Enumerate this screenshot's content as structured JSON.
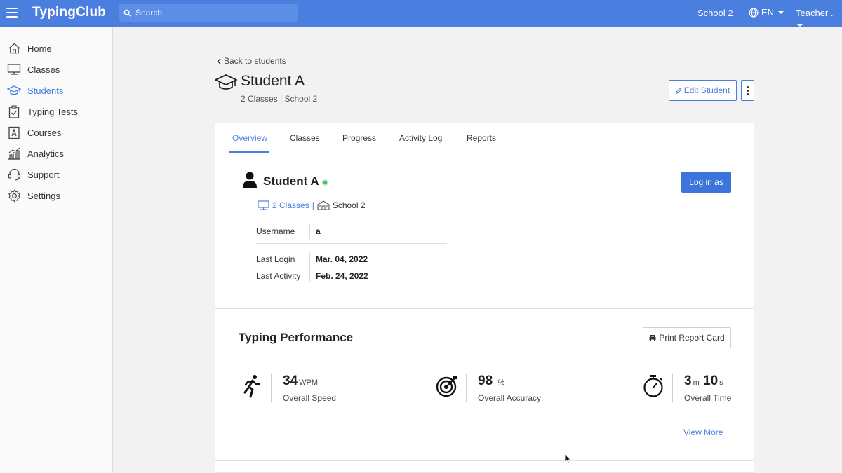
{
  "topbar": {
    "logo": "TypingClub",
    "search_placeholder": "Search",
    "school": "School 2",
    "language": "EN",
    "user": "Teacher ."
  },
  "sidebar": {
    "items": [
      {
        "label": "Home",
        "icon": "home-icon"
      },
      {
        "label": "Classes",
        "icon": "monitor-icon"
      },
      {
        "label": "Students",
        "icon": "graduation-cap-icon",
        "active": true
      },
      {
        "label": "Typing Tests",
        "icon": "clipboard-check-icon"
      },
      {
        "label": "Courses",
        "icon": "course-book-icon"
      },
      {
        "label": "Analytics",
        "icon": "bar-chart-icon"
      },
      {
        "label": "Support",
        "icon": "headset-icon"
      },
      {
        "label": "Settings",
        "icon": "gear-icon"
      }
    ]
  },
  "header": {
    "back_label": "Back to students",
    "title": "Student A",
    "subtitle": "2 Classes | School 2",
    "edit_label": "Edit Student"
  },
  "tabs": [
    "Overview",
    "Classes",
    "Progress",
    "Activity Log",
    "Reports"
  ],
  "active_tab": "Overview",
  "student": {
    "name": "Student A",
    "status": "online",
    "login_as_label": "Log in as",
    "classes_link": "2 Classes",
    "separator": "|",
    "school": "School 2",
    "username_label": "Username",
    "username": "a",
    "last_login_label": "Last Login",
    "last_login": "Mar. 04, 2022",
    "last_activity_label": "Last Activity",
    "last_activity": "Feb. 24, 2022"
  },
  "performance": {
    "title": "Typing Performance",
    "print_label": "Print Report Card",
    "speed": {
      "value": "34",
      "unit": "WPM",
      "label": "Overall Speed"
    },
    "accuracy": {
      "value": "98",
      "unit": "%",
      "label": "Overall Accuracy"
    },
    "time": {
      "minutes": "3",
      "minutes_unit": "m",
      "seconds": "10",
      "seconds_unit": "s",
      "label": "Overall Time"
    },
    "view_more": "View More"
  },
  "colors": {
    "accent": "#4a7fe0",
    "topbar": "#4a7fe0",
    "online": "#3cbf5a"
  }
}
